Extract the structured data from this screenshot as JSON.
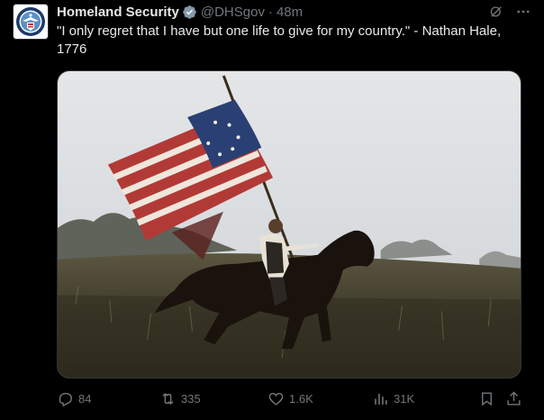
{
  "post": {
    "author": {
      "display_name": "Homeland Security",
      "handle": "@DHSgov",
      "separator": "·",
      "time": "48m",
      "verified": true,
      "verified_color": "#829aab",
      "avatar_icon": "dhs-seal-icon"
    },
    "text": "\"I only regret that I have but one life to give for my country.\" - Nathan Hale, 1776",
    "media": {
      "kind": "photo",
      "content_icon": "rider-with-flag-photo"
    },
    "header_icons": [
      "grok-icon",
      "more-icon"
    ],
    "actions": {
      "reply": {
        "count": "84",
        "icon": "reply-icon"
      },
      "retweet": {
        "count": "335",
        "icon": "retweet-icon"
      },
      "like": {
        "count": "1.6K",
        "icon": "heart-icon"
      },
      "views": {
        "count": "31K",
        "icon": "views-icon"
      },
      "bookmark": {
        "icon": "bookmark-icon"
      },
      "share": {
        "icon": "share-icon"
      }
    }
  },
  "colors": {
    "background": "#000000",
    "text_primary": "#e7e9ea",
    "text_secondary": "#71767b",
    "border": "#2f3336"
  }
}
